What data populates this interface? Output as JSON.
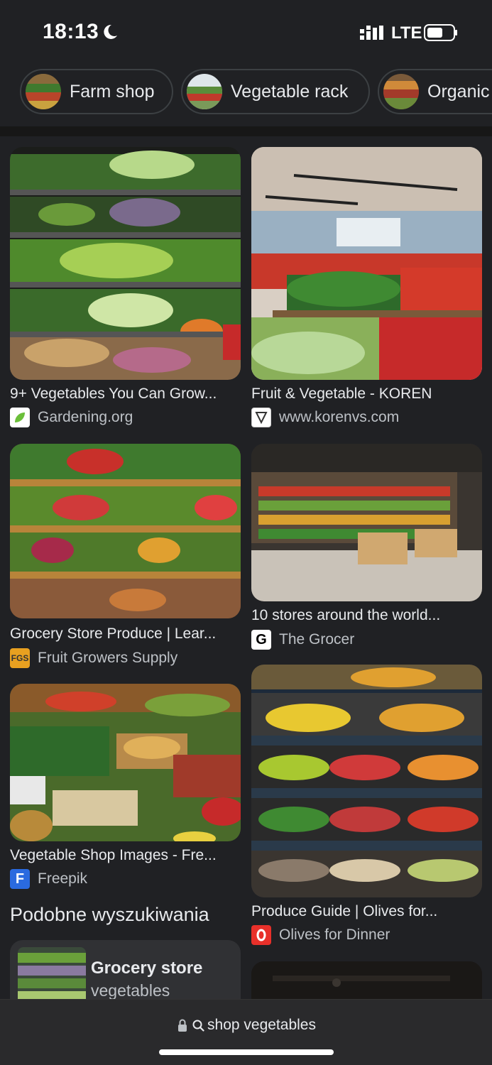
{
  "status": {
    "time": "18:13",
    "network": "LTE"
  },
  "chips": [
    {
      "label": "Farm shop"
    },
    {
      "label": "Vegetable rack"
    },
    {
      "label": "Organic"
    }
  ],
  "results": [
    {
      "title": "9+ Vegetables You Can Grow...",
      "source": "Gardening.org"
    },
    {
      "title": "Fruit & Vegetable - KOREN",
      "source": "www.korenvs.com"
    },
    {
      "title": "Grocery Store Produce | Lear...",
      "source": "Fruit Growers Supply"
    },
    {
      "title": "10 stores around the world...",
      "source": "The Grocer"
    },
    {
      "title": "Vegetable Shop Images - Fre...",
      "source": "Freepik"
    },
    {
      "title": "Produce Guide | Olives for...",
      "source": "Olives for Dinner"
    }
  ],
  "related": {
    "heading": "Podobne wyszukiwania",
    "items": [
      {
        "line1": "Grocery store",
        "line2": "vegetables"
      }
    ]
  },
  "address_bar": {
    "query": "shop vegetables"
  },
  "colors": {
    "background": "#202124",
    "chip_border": "#3c4043",
    "text": "#e8eaed",
    "subtext": "#bdc1c6"
  }
}
